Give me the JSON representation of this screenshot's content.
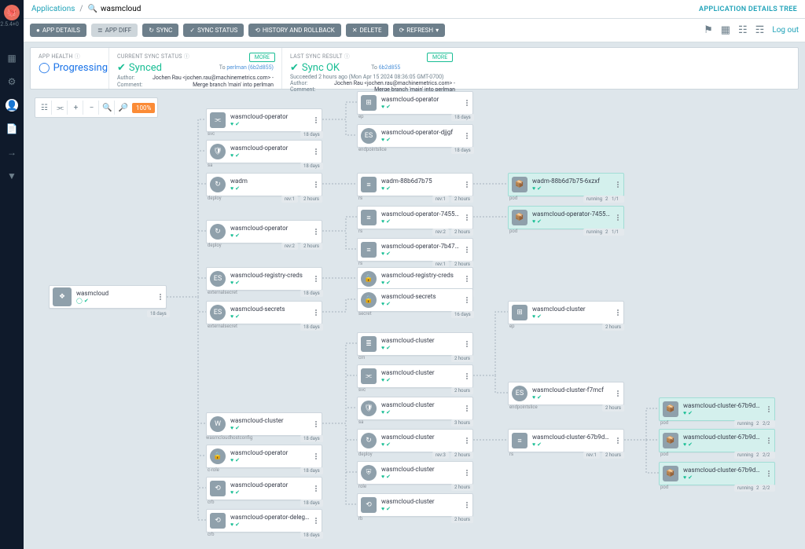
{
  "version_label": "v2.5.4+0",
  "breadcrumb": {
    "applications": "Applications",
    "current": "wasmcloud"
  },
  "search": {
    "placeholder": "wasmcloud"
  },
  "page_title": "APPLICATION DETAILS TREE",
  "toolbar": {
    "app_details": "APP DETAILS",
    "app_diff": "APP DIFF",
    "sync": "SYNC",
    "sync_status": "SYNC STATUS",
    "history": "HISTORY AND ROLLBACK",
    "delete": "DELETE",
    "refresh": "REFRESH",
    "logout": "Log out"
  },
  "health": {
    "label": "APP HEALTH",
    "value": "Progressing"
  },
  "sync_status": {
    "label": "CURRENT SYNC STATUS",
    "value": "Synced",
    "more": "MORE",
    "to_label": "To",
    "rev": "perlman (6b2d855)",
    "author_lbl": "Author:",
    "comment_lbl": "Comment:",
    "author": "Jochen Rau <jochen.rau@machinemetrics.com> -",
    "comment": "Merge branch 'main' into perlman"
  },
  "last_sync": {
    "label": "LAST SYNC RESULT",
    "value": "Sync OK",
    "more": "MORE",
    "ago": "Succeeded 2 hours ago (Mon Apr 15 2024 08:36:05 GMT-0700)",
    "to_label": "To",
    "rev": "6b2d855",
    "author_lbl": "Author:",
    "comment_lbl": "Comment:",
    "author": "Jochen Rau <jochen.rau@machinemetrics.com> -",
    "comment": "Merge branch 'main' into perlman"
  },
  "zoom": "100%",
  "root": {
    "name": "wasmcloud",
    "age": "18 days"
  },
  "badges": {
    "d18": "18 days",
    "d16": "16 days",
    "h2": "2 hours",
    "h3": "3 hours",
    "rev1": "rev:1",
    "rev2": "rev:2",
    "rev3": "rev:3",
    "run": "running",
    "c11": "1/1",
    "c22": "2/2"
  },
  "col2": [
    {
      "name": "wasmcloud-operator",
      "kind": "svc",
      "age": "18 days"
    },
    {
      "name": "wasmcloud-operator",
      "kind": "sa",
      "age": "18 days"
    },
    {
      "name": "wadm",
      "kind": "deploy",
      "age": "2 hours",
      "rev": "rev:1"
    },
    {
      "name": "wasmcloud-operator",
      "kind": "deploy",
      "age": "2 hours",
      "rev": "rev:2"
    },
    {
      "name": "wasmcloud-registry-creds",
      "kind": "externalsecret",
      "age": "18 days"
    },
    {
      "name": "wasmcloud-secrets",
      "kind": "externalsecret",
      "age": "18 days"
    },
    {
      "name": "wasmcloud-cluster",
      "kind": "WCHC",
      "age": "18 days"
    },
    {
      "name": "wasmcloud-operator",
      "kind": "c-role",
      "age": "18 days"
    },
    {
      "name": "wasmcloud-operator",
      "kind": "crb",
      "age": "18 days"
    },
    {
      "name": "wasmcloud-operator-delegator",
      "kind": "crb",
      "age": "18 days"
    }
  ],
  "col3": [
    {
      "name": "wasmcloud-operator",
      "kind": "ep",
      "age": "18 days"
    },
    {
      "name": "wasmcloud-operator-djjgf",
      "kind": "endpointslice",
      "age": "18 days"
    },
    {
      "name": "wadm-88b6d7b75",
      "kind": "rs",
      "age": "2 hours",
      "rev": "rev:1"
    },
    {
      "name": "wasmcloud-operator-745559...",
      "kind": "rs",
      "age": "2 hours",
      "rev": "rev:2"
    },
    {
      "name": "wasmcloud-operator-7b4774...",
      "kind": "rs",
      "age": "2 hours",
      "rev": "rev:1"
    },
    {
      "name": "wasmcloud-registry-creds",
      "kind": "secret",
      "age": "18 days"
    },
    {
      "name": "wasmcloud-secrets",
      "kind": "secret",
      "age": "16 days"
    },
    {
      "name": "wasmcloud-cluster",
      "kind": "cm",
      "age": "2 hours"
    },
    {
      "name": "wasmcloud-cluster",
      "kind": "svc",
      "age": "2 hours"
    },
    {
      "name": "wasmcloud-cluster",
      "kind": "sa",
      "age": "3 hours"
    },
    {
      "name": "wasmcloud-cluster",
      "kind": "deploy",
      "age": "2 hours",
      "rev": "rev:3"
    },
    {
      "name": "wasmcloud-cluster",
      "kind": "role",
      "age": "2 hours"
    },
    {
      "name": "wasmcloud-cluster",
      "kind": "rb",
      "age": "2 hours"
    }
  ],
  "col4": [
    {
      "name": "wadm-88b6d7b75-6xzxf",
      "kind": "pod",
      "age": "2 hours",
      "status": "running",
      "count": "1/1",
      "hl": true
    },
    {
      "name": "wasmcloud-operator-745559...",
      "kind": "pod",
      "age": "2 hours",
      "status": "running",
      "count": "1/1",
      "hl": true
    },
    {
      "name": "wasmcloud-cluster",
      "kind": "ep",
      "age": "2 hours"
    },
    {
      "name": "wasmcloud-cluster-f7mcf",
      "kind": "endpointslice",
      "age": "2 hours"
    },
    {
      "name": "wasmcloud-cluster-67b9d7bc...",
      "kind": "rs",
      "age": "2 hours",
      "rev": "rev:1"
    }
  ],
  "col5": [
    {
      "name": "wasmcloud-cluster-67b9d7bc...",
      "kind": "pod",
      "age": "2 hours",
      "status": "running",
      "count": "2/2",
      "hl": true
    },
    {
      "name": "wasmcloud-cluster-67b9d7bc...",
      "kind": "pod",
      "age": "2 hours",
      "status": "running",
      "count": "2/2",
      "hl": true
    },
    {
      "name": "wasmcloud-cluster-67b9d7bc...",
      "kind": "pod",
      "age": "2 hours",
      "status": "running",
      "count": "2/2",
      "hl": true
    }
  ],
  "wchc_label": "wasmcloudhostconfig"
}
